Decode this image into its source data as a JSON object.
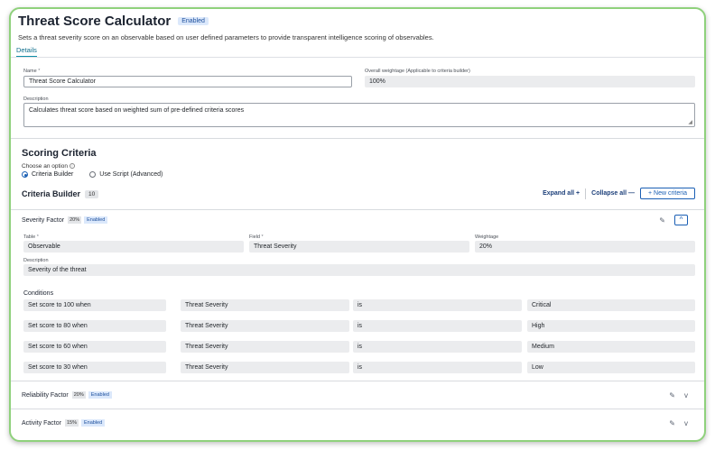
{
  "header": {
    "title": "Threat Score Calculator",
    "status": "Enabled",
    "subtitle": "Sets a threat severity score on an observable based on user defined parameters to provide transparent intelligence scoring of observables.",
    "tab": "Details"
  },
  "details": {
    "name_label": "Name",
    "name_value": "Threat Score Calculator",
    "weightage_label": "Overall weightage (Applicable to criteria builder)",
    "weightage_value": "100%",
    "description_label": "Description",
    "description_value": "Calculates threat score based on weighted sum of pre-defined criteria scores"
  },
  "scoring": {
    "title": "Scoring Criteria",
    "choose_label": "Choose an option",
    "option_builder": "Criteria Builder",
    "option_script": "Use Script (Advanced)",
    "builder_title": "Criteria Builder",
    "builder_count": "10",
    "expand_all": "Expand all",
    "collapse_all": "Collapse all",
    "new_criteria": "New criteria"
  },
  "factors": [
    {
      "name": "Severity Factor",
      "weight": "20%",
      "status": "Enabled",
      "table_label": "Table",
      "table_value": "Observable",
      "field_label": "Field",
      "field_value": "Threat Severity",
      "weightage_label": "Weightage",
      "weightage_value": "20%",
      "description_label": "Description",
      "description_value": "Severity of the threat",
      "conditions_label": "Conditions",
      "conditions": [
        {
          "score": "Set score to 100 when",
          "field": "Threat Severity",
          "op": "is",
          "value": "Critical"
        },
        {
          "score": "Set score to 80 when",
          "field": "Threat Severity",
          "op": "is",
          "value": "High"
        },
        {
          "score": "Set score to 60 when",
          "field": "Threat Severity",
          "op": "is",
          "value": "Medium"
        },
        {
          "score": "Set score to 30 when",
          "field": "Threat Severity",
          "op": "is",
          "value": "Low"
        }
      ]
    },
    {
      "name": "Reliability Factor",
      "weight": "20%",
      "status": "Enabled"
    },
    {
      "name": "Activity Factor",
      "weight": "15%",
      "status": "Enabled"
    }
  ],
  "icons": {
    "plus": "+",
    "minus": "—",
    "chevron_up": "^",
    "chevron_down": "v"
  },
  "colors": {
    "frame_border": "#8fd17c",
    "accent": "#1a5fb4",
    "enabled_bg": "#dbe8fb"
  }
}
